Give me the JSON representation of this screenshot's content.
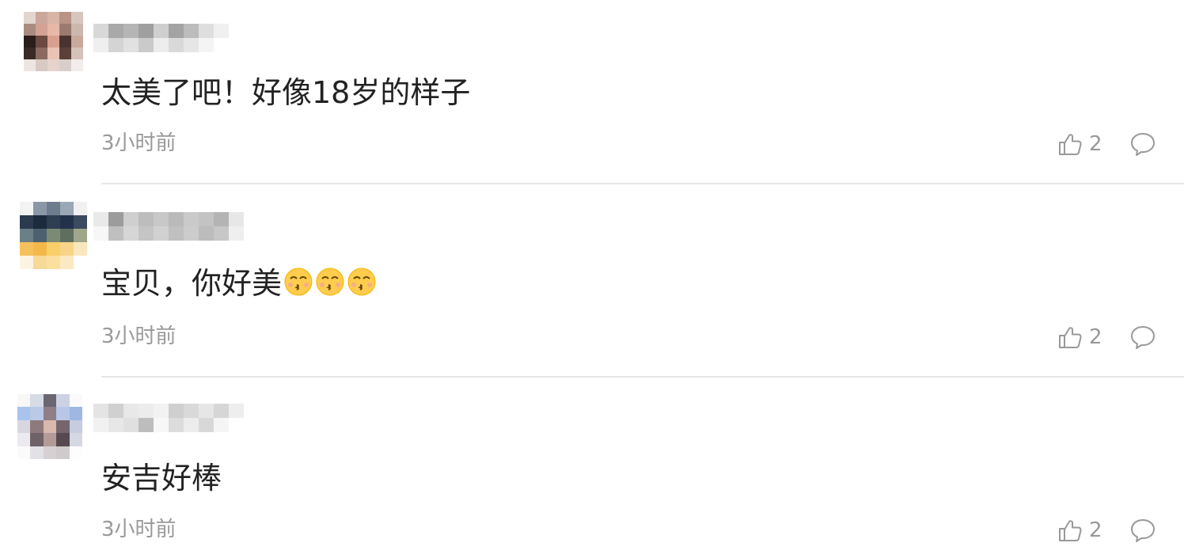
{
  "comments": [
    {
      "text": "太美了吧！好像18岁的样子",
      "time": "3小时前",
      "likes": "2",
      "emoji_count": 0,
      "avatar_colors": [
        "#e3d6cf",
        "#c9a79a",
        "#d8b5a6",
        "#b99384",
        "#d7c6bd",
        "#a88c80",
        "#d2a394",
        "#e7b8a8",
        "#9b7b6f",
        "#cbb7ad",
        "#2a1d1a",
        "#6b4a40",
        "#d9a08f",
        "#4a3430",
        "#c8a99c",
        "#3a2a27",
        "#8b6a5f",
        "#e9c3b4",
        "#5b4039",
        "#d4c2ba",
        "#ece5e1",
        "#d8c9c2",
        "#e6d3cb",
        "#d9cfca",
        "#f2ecea"
      ],
      "name_colors": [
        "#d8d8d8",
        "#a9a9a9",
        "#b5b5b5",
        "#9f9f9f",
        "#cfcfcf",
        "#a3a3a3",
        "#bcbcbc",
        "#dedede",
        "#f0f0f0",
        "#ffffff",
        "#efefef",
        "#d4d4d4",
        "#e1e1e1",
        "#cacaca",
        "#ececec",
        "#d9d9d9",
        "#e6e6e6",
        "#f4f4f4",
        "#ffffff",
        "#ffffff"
      ]
    },
    {
      "text": "宝贝，你好美",
      "time": "3小时前",
      "likes": "2",
      "emoji_count": 3,
      "avatar_colors": [
        "#f3f3f3",
        "#8a97a6",
        "#6d7d8e",
        "#9aa7b4",
        "#f1f1f1",
        "#2b3a4e",
        "#1d2b3f",
        "#2f3e52",
        "#22324a",
        "#3b4a5e",
        "#6b7f86",
        "#4c6170",
        "#7b8a73",
        "#5f6e5e",
        "#a0a68a",
        "#f6c15c",
        "#f3b84a",
        "#f9cf6a",
        "#f7d487",
        "#fbe7bd",
        "#fdf3e2",
        "#f7d998",
        "#fadf9f",
        "#fce9c4",
        "#ffffff"
      ],
      "name_colors": [
        "#e9e9e9",
        "#9c9c9c",
        "#cfcfcf",
        "#bdbdbd",
        "#c8c8c8",
        "#bababa",
        "#cacaca",
        "#c3c3c3",
        "#b4b4b4",
        "#e7e7e7",
        "#f7f7f7",
        "#bfbfbf",
        "#d6d6d6",
        "#c5c5c5",
        "#d1d1d1",
        "#c0c0c0",
        "#cccccc",
        "#bcbcbc",
        "#c7c7c7",
        "#efefef"
      ]
    },
    {
      "text": "安吉好棒",
      "time": "3小时前",
      "likes": "2",
      "emoji_count": 0,
      "avatar_colors": [
        "#f7f7f7",
        "#d6dbe6",
        "#6c6671",
        "#ccd2e4",
        "#fafafa",
        "#a9c3ec",
        "#b9c9e6",
        "#8f7f86",
        "#b8c6e8",
        "#9eb8e3",
        "#d8d6e0",
        "#8e7a7d",
        "#d9b8ad",
        "#75656c",
        "#c6cde0",
        "#eaeaf0",
        "#6e6268",
        "#b39c98",
        "#58484f",
        "#d5d8e2",
        "#fbfbfb",
        "#e2e2e6",
        "#d6d0d2",
        "#cfcbcc",
        "#fdfdfd"
      ],
      "name_colors": [
        "#e4e4e4",
        "#d0d0d0",
        "#e8e8e8",
        "#ececec",
        "#f2f2f2",
        "#cfcfcf",
        "#d9d9d9",
        "#e6e6e6",
        "#d6d6d6",
        "#eeeeee",
        "#f1f1f1",
        "#e7e7e7",
        "#e0e0e0",
        "#bdbdbd",
        "#f7f7f7",
        "#dcdcdc",
        "#ececec",
        "#d8d8d8",
        "#f5f5f5",
        "#ffffff"
      ]
    }
  ]
}
